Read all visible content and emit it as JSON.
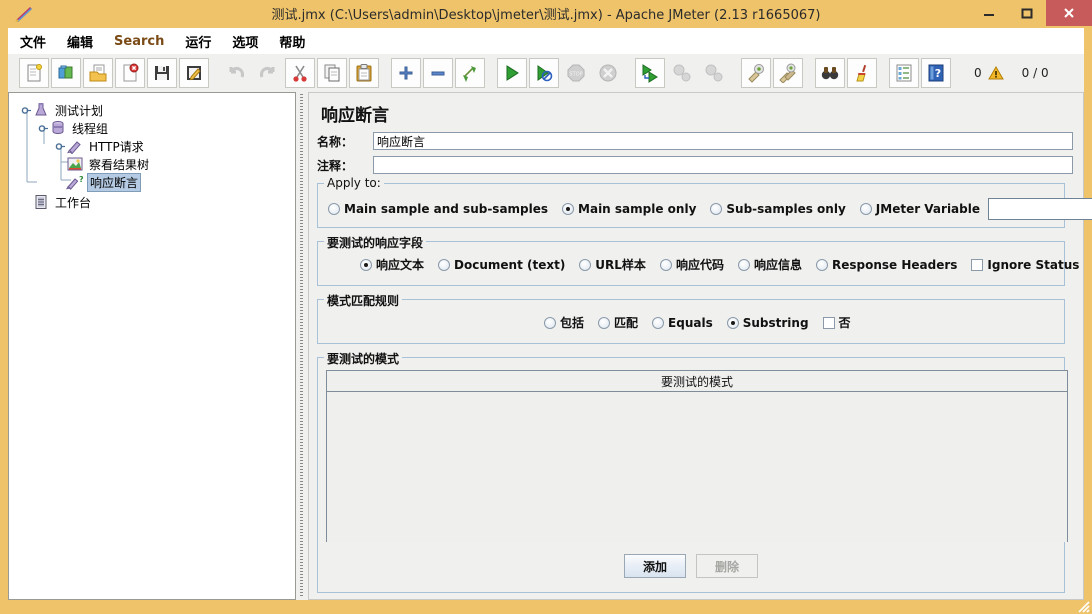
{
  "window": {
    "title": "测试.jmx (C:\\Users\\admin\\Desktop\\jmeter\\测试.jmx) - Apache JMeter (2.13 r1665067)",
    "minimize_label": "—",
    "maximize_label": "□",
    "close_label": "✕"
  },
  "menu": {
    "items": [
      {
        "label": "文件",
        "alt": false
      },
      {
        "label": "编辑",
        "alt": false
      },
      {
        "label": "Search",
        "alt": true
      },
      {
        "label": "运行",
        "alt": false
      },
      {
        "label": "选项",
        "alt": false
      },
      {
        "label": "帮助",
        "alt": false
      }
    ]
  },
  "toolbar": {
    "buttons": [
      {
        "name": "new-icon",
        "enabled": true
      },
      {
        "name": "templates-icon",
        "enabled": true
      },
      {
        "name": "open-icon",
        "enabled": true
      },
      {
        "name": "close-icon",
        "enabled": true
      },
      {
        "name": "save-icon",
        "enabled": true
      },
      {
        "name": "save-as-icon",
        "enabled": true
      },
      {
        "name": "undo-icon",
        "enabled": false
      },
      {
        "name": "redo-icon",
        "enabled": false
      },
      {
        "name": "cut-icon",
        "enabled": true
      },
      {
        "name": "copy-icon",
        "enabled": true
      },
      {
        "name": "paste-icon",
        "enabled": true
      },
      {
        "name": "expand-all-icon",
        "enabled": true
      },
      {
        "name": "collapse-all-icon",
        "enabled": true
      },
      {
        "name": "toggle-icon",
        "enabled": true
      },
      {
        "name": "start-icon",
        "enabled": true
      },
      {
        "name": "start-no-timers-icon",
        "enabled": true
      },
      {
        "name": "stop-icon",
        "enabled": false
      },
      {
        "name": "shutdown-icon",
        "enabled": false
      },
      {
        "name": "remote-start-all-icon",
        "enabled": true
      },
      {
        "name": "remote-stop-all-icon",
        "enabled": false
      },
      {
        "name": "remote-shutdown-all-icon",
        "enabled": false
      },
      {
        "name": "clear-icon",
        "enabled": true
      },
      {
        "name": "clear-all-icon",
        "enabled": true
      },
      {
        "name": "search-icon",
        "enabled": true
      },
      {
        "name": "search-reset-icon",
        "enabled": true
      },
      {
        "name": "function-helper-icon",
        "enabled": true
      },
      {
        "name": "help-icon",
        "enabled": true
      }
    ],
    "status": {
      "warning_count": "0",
      "warning_icon": "warning-triangle-icon",
      "thread_counts": "0 / 0"
    }
  },
  "tree": {
    "nodes": [
      {
        "label": "测试计划",
        "icon": "test-plan-icon",
        "indent": 0,
        "selected": false,
        "expanded": true
      },
      {
        "label": "线程组",
        "icon": "thread-group-icon",
        "indent": 1,
        "selected": false,
        "expanded": true
      },
      {
        "label": "HTTP请求",
        "icon": "http-request-icon",
        "indent": 2,
        "selected": false,
        "expanded": true
      },
      {
        "label": "察看结果树",
        "icon": "view-results-tree-icon",
        "indent": 2,
        "selected": false,
        "expanded": false
      },
      {
        "label": "响应断言",
        "icon": "response-assertion-icon",
        "indent": 2,
        "selected": true,
        "expanded": false
      },
      {
        "label": "工作台",
        "icon": "workbench-icon",
        "indent": 0,
        "selected": false,
        "expanded": false
      }
    ]
  },
  "panel": {
    "title": "响应断言",
    "name_label": "名称：",
    "name_value": "响应断言",
    "comment_label": "注释：",
    "comment_value": "",
    "apply_to": {
      "title": "Apply to:",
      "options": [
        {
          "label": "Main sample and sub-samples",
          "selected": false
        },
        {
          "label": "Main sample only",
          "selected": true
        },
        {
          "label": "Sub-samples only",
          "selected": false
        },
        {
          "label": "JMeter Variable",
          "selected": false
        }
      ],
      "variable_value": ""
    },
    "response_field": {
      "title": "要测试的响应字段",
      "options": [
        {
          "label": "响应文本",
          "selected": true
        },
        {
          "label": "Document (text)",
          "selected": false
        },
        {
          "label": "URL样本",
          "selected": false
        },
        {
          "label": "响应代码",
          "selected": false
        },
        {
          "label": "响应信息",
          "selected": false
        },
        {
          "label": "Response Headers",
          "selected": false
        }
      ],
      "ignore_status": {
        "label": "Ignore Status",
        "checked": false
      }
    },
    "pattern_rules": {
      "title": "模式匹配规则",
      "options": [
        {
          "label": "包括",
          "selected": false
        },
        {
          "label": "匹配",
          "selected": false
        },
        {
          "label": "Equals",
          "selected": false
        },
        {
          "label": "Substring",
          "selected": true
        }
      ],
      "negate": {
        "label": "否",
        "checked": false
      }
    },
    "patterns": {
      "title": "要测试的模式",
      "column_header": "要测试的模式",
      "rows": [],
      "add_button": "添加",
      "delete_button": "删除",
      "delete_enabled": false
    }
  },
  "colors": {
    "window_frame": "#eec36a",
    "close_button": "#c75b5b",
    "panel_bg": "#f0f0ef",
    "tree_selection": "#b5cbe3",
    "group_border": "#a8c0d8",
    "menu_alt_text": "#7a4a17"
  }
}
